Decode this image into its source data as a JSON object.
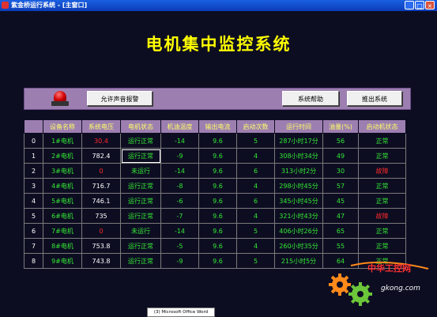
{
  "window": {
    "title": "紫金桥运行系统 - [主窗口]",
    "min_glyph": "_",
    "max_glyph": "□",
    "close_glyph": "×"
  },
  "header": {
    "title": "电机集中监控系统"
  },
  "controls": {
    "sound_alarm_label": "允许声音报警",
    "help_label": "系统帮助",
    "exit_label": "推出系统"
  },
  "table": {
    "columns": [
      "设备名称",
      "系统电压",
      "电机状态",
      "机油温度",
      "输出电流",
      "启动次数",
      "运行时间",
      "油量(%)",
      "启动机状态"
    ],
    "rows": [
      {
        "idx": "0",
        "name": "1#电机",
        "voltage": "30.4",
        "voltage_color": "red",
        "state": "运行正常",
        "oil_temp": "-14",
        "current": "9.6",
        "starts": "5",
        "runtime": "287小时17分",
        "oil": "56",
        "starter": "正常",
        "starter_color": "green"
      },
      {
        "idx": "1",
        "name": "2#电机",
        "voltage": "782.4",
        "voltage_color": "white",
        "state": "运行正常",
        "oil_temp": "-9",
        "current": "9.6",
        "starts": "4",
        "runtime": "308小时34分",
        "oil": "49",
        "starter": "正常",
        "starter_color": "green"
      },
      {
        "idx": "2",
        "name": "3#电机",
        "voltage": "0",
        "voltage_color": "red",
        "state": "未运行",
        "oil_temp": "-14",
        "current": "9.6",
        "starts": "6",
        "runtime": "313小时2分",
        "oil": "30",
        "starter": "故障",
        "starter_color": "red"
      },
      {
        "idx": "3",
        "name": "4#电机",
        "voltage": "716.7",
        "voltage_color": "white",
        "state": "运行正常",
        "oil_temp": "-8",
        "current": "9.6",
        "starts": "4",
        "runtime": "298小时45分",
        "oil": "57",
        "starter": "正常",
        "starter_color": "green"
      },
      {
        "idx": "4",
        "name": "5#电机",
        "voltage": "746.1",
        "voltage_color": "white",
        "state": "运行正常",
        "oil_temp": "-6",
        "current": "9.6",
        "starts": "6",
        "runtime": "345小时45分",
        "oil": "45",
        "starter": "正常",
        "starter_color": "green"
      },
      {
        "idx": "5",
        "name": "6#电机",
        "voltage": "735",
        "voltage_color": "white",
        "state": "运行正常",
        "oil_temp": "-7",
        "current": "9.6",
        "starts": "4",
        "runtime": "321小时43分",
        "oil": "47",
        "starter": "故障",
        "starter_color": "red"
      },
      {
        "idx": "6",
        "name": "7#电机",
        "voltage": "0",
        "voltage_color": "red",
        "state": "未运行",
        "oil_temp": "-14",
        "current": "9.6",
        "starts": "5",
        "runtime": "406小时26分",
        "oil": "65",
        "starter": "正常",
        "starter_color": "green"
      },
      {
        "idx": "7",
        "name": "8#电机",
        "voltage": "753.8",
        "voltage_color": "white",
        "state": "运行正常",
        "oil_temp": "-5",
        "current": "9.6",
        "starts": "4",
        "runtime": "260小时35分",
        "oil": "55",
        "starter": "正常",
        "starter_color": "green"
      },
      {
        "idx": "8",
        "name": "9#电机",
        "voltage": "743.8",
        "voltage_color": "white",
        "state": "运行正常",
        "oil_temp": "-9",
        "current": "9.6",
        "starts": "5",
        "runtime": "215小时5分",
        "oil": "64",
        "starter": "正常",
        "starter_color": "green"
      }
    ]
  },
  "statusbar": {
    "text": "(3) Microsoft Office Word"
  },
  "watermark": {
    "name": "中华工控网",
    "url": "gkong.com"
  },
  "colors": {
    "accent_panel": "#9c7fb0",
    "title_yellow": "#ffff00",
    "ok_green": "#33e833",
    "fault_red": "#ff2a2a",
    "background": "#0d0d22"
  }
}
